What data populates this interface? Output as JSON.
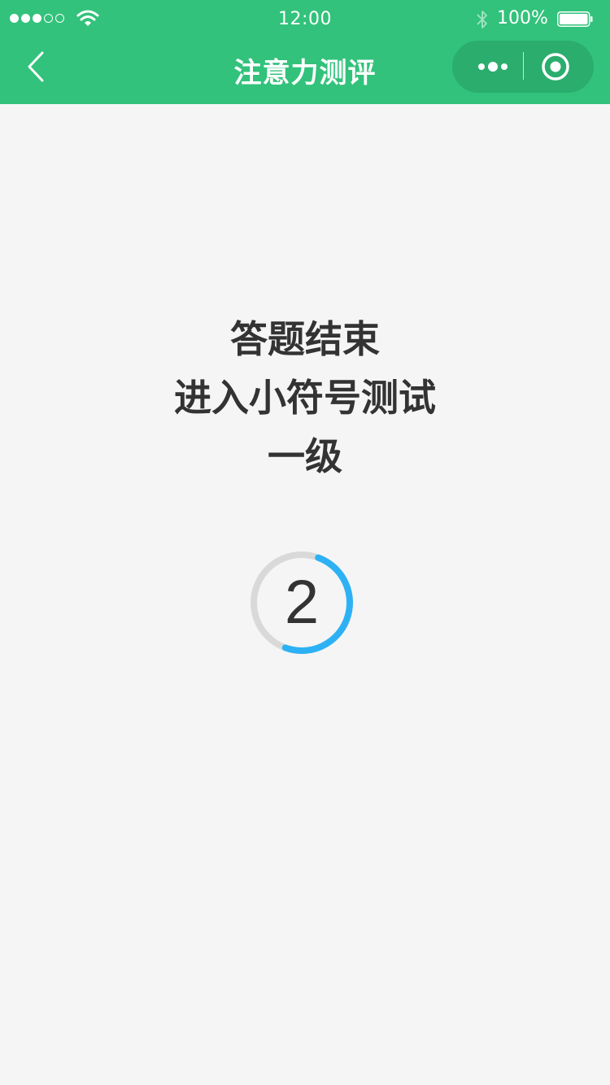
{
  "status_bar": {
    "time": "12:00",
    "battery_percent": "100%",
    "signal_dots_filled": 3,
    "signal_dots_total": 5,
    "battery_level": 1.0
  },
  "nav": {
    "title": "注意力测评",
    "back_icon": "chevron-left-icon",
    "more_icon": "more-dots-icon",
    "close_icon": "target-circle-icon"
  },
  "message": {
    "line1": "答题结束",
    "line2": "进入小符号测试",
    "line3": "一级"
  },
  "countdown": {
    "value": "2",
    "progress": 0.5
  },
  "colors": {
    "brand": "#32c27b",
    "accent": "#2db1f5",
    "track": "#d9d9d9",
    "text": "#333333",
    "background": "#f5f5f5"
  }
}
